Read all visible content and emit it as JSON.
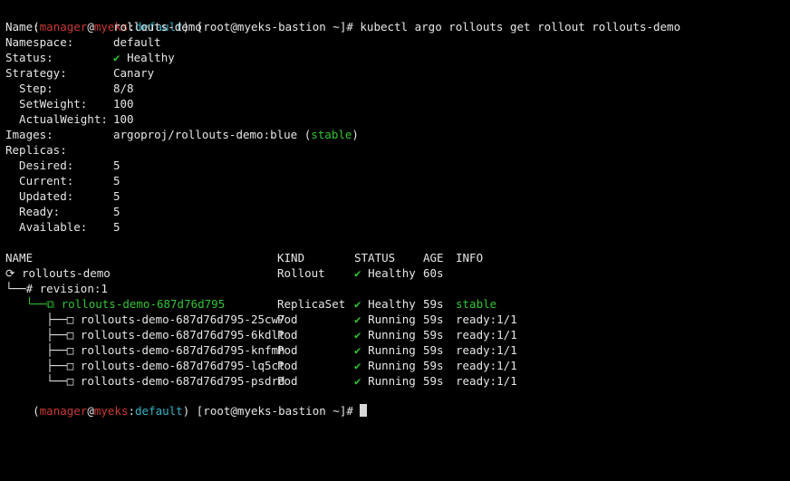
{
  "prompt1": {
    "open": "(",
    "user": "manager",
    "at": "@",
    "host": "myeks",
    "colon": ":",
    "ns": "default",
    "close": ")",
    "rest": " [root@myeks-bastion ~]# ",
    "command": "kubectl argo rollouts get rollout rollouts-demo"
  },
  "info": {
    "name": {
      "label": "Name:",
      "value": "rollouts-demo"
    },
    "namespace": {
      "label": "Namespace:",
      "value": "default"
    },
    "status": {
      "label": "Status:",
      "icon": "✔",
      "value": "Healthy"
    },
    "strategy": {
      "label": "Strategy:",
      "value": "Canary"
    },
    "step": {
      "label": "  Step:",
      "value": "8/8"
    },
    "setweight": {
      "label": "  SetWeight:",
      "value": "100"
    },
    "actualweight": {
      "label": "  ActualWeight:",
      "value": "100"
    },
    "images": {
      "label": "Images:",
      "value": "argoproj/rollouts-demo:blue (",
      "tag": "stable",
      "close": ")"
    },
    "replicas": {
      "label": "Replicas:"
    },
    "desired": {
      "label": "  Desired:",
      "value": "5"
    },
    "current": {
      "label": "  Current:",
      "value": "5"
    },
    "updated": {
      "label": "  Updated:",
      "value": "5"
    },
    "ready": {
      "label": "  Ready:",
      "value": "5"
    },
    "available": {
      "label": "  Available:",
      "value": "5"
    }
  },
  "table": {
    "headers": {
      "name": "NAME",
      "kind": "KIND",
      "status": "STATUS",
      "age": "AGE",
      "info": "INFO"
    },
    "rows": [
      {
        "tree": "⟳ ",
        "name": "rollouts-demo",
        "kind": "Rollout",
        "icon": "✔",
        "status": "Healthy",
        "age": "60s",
        "info": ""
      },
      {
        "tree": "└──# ",
        "name": "revision:1",
        "kind": "",
        "icon": "",
        "status": "",
        "age": "",
        "info": ""
      },
      {
        "tree": "   └──⧉ ",
        "name": "rollouts-demo-687d76d795",
        "kind": "ReplicaSet",
        "icon": "✔",
        "status": "Healthy",
        "age": "59s",
        "info": "stable"
      },
      {
        "tree": "      ├──□ ",
        "name": "rollouts-demo-687d76d795-25cw7",
        "kind": "Pod",
        "icon": "✔",
        "status": "Running",
        "age": "59s",
        "info": "ready:1/1"
      },
      {
        "tree": "      ├──□ ",
        "name": "rollouts-demo-687d76d795-6kdlt",
        "kind": "Pod",
        "icon": "✔",
        "status": "Running",
        "age": "59s",
        "info": "ready:1/1"
      },
      {
        "tree": "      ├──□ ",
        "name": "rollouts-demo-687d76d795-knfmh",
        "kind": "Pod",
        "icon": "✔",
        "status": "Running",
        "age": "59s",
        "info": "ready:1/1"
      },
      {
        "tree": "      ├──□ ",
        "name": "rollouts-demo-687d76d795-lq5ct",
        "kind": "Pod",
        "icon": "✔",
        "status": "Running",
        "age": "59s",
        "info": "ready:1/1"
      },
      {
        "tree": "      └──□ ",
        "name": "rollouts-demo-687d76d795-psdrd",
        "kind": "Pod",
        "icon": "✔",
        "status": "Running",
        "age": "59s",
        "info": "ready:1/1"
      }
    ]
  },
  "prompt2": {
    "open": "(",
    "user": "manager",
    "at": "@",
    "host": "myeks",
    "colon": ":",
    "ns": "default",
    "close": ")",
    "rest": " [root@myeks-bastion ~]# "
  },
  "colors": {
    "user": "#c93a34",
    "namespace": "#37b2c8",
    "ok": "#30c430",
    "text": "#e6e6e6",
    "background": "#000000"
  }
}
